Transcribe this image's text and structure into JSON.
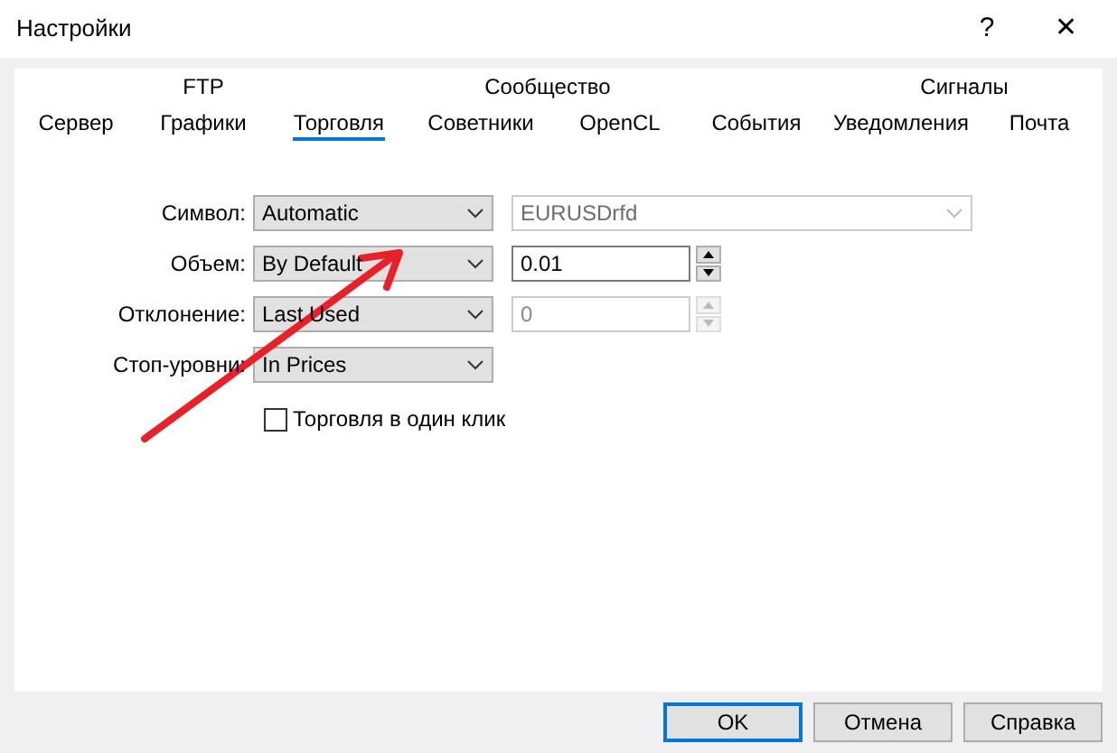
{
  "window": {
    "title": "Настройки",
    "help": "?",
    "close": "✕"
  },
  "tab_rows": [
    [
      {
        "label": "FTP",
        "selected": false
      },
      {
        "label": "Сообщество",
        "selected": false
      },
      {
        "label": "Сигналы",
        "selected": false
      }
    ],
    [
      {
        "label": "Сервер",
        "selected": false
      },
      {
        "label": "Графики",
        "selected": false
      },
      {
        "label": "Торговля",
        "selected": true
      },
      {
        "label": "Советники",
        "selected": false
      },
      {
        "label": "OpenCL",
        "selected": false
      },
      {
        "label": "События",
        "selected": false
      },
      {
        "label": "Уведомления",
        "selected": false
      },
      {
        "label": "Почта",
        "selected": false
      }
    ]
  ],
  "fields": [
    {
      "label": "Символ:",
      "value": "Automatic",
      "extra": {
        "kind": "combo",
        "value": "EURUSDrfd",
        "disabled": true
      }
    },
    {
      "label": "Объем:",
      "value": "By Default",
      "extra": {
        "kind": "spin",
        "value": "0.01",
        "disabled": false
      }
    },
    {
      "label": "Отклонение:",
      "value": "Last Used",
      "extra": {
        "kind": "spin",
        "value": "0",
        "disabled": true
      }
    },
    {
      "label": "Стоп-уровни:",
      "value": "In Prices"
    }
  ],
  "checkbox": {
    "label": "Торговля в один клик",
    "checked": false
  },
  "buttons": [
    {
      "label": "OK",
      "default": true
    },
    {
      "label": "Отмена",
      "default": false
    },
    {
      "label": "Справка",
      "default": false
    }
  ]
}
